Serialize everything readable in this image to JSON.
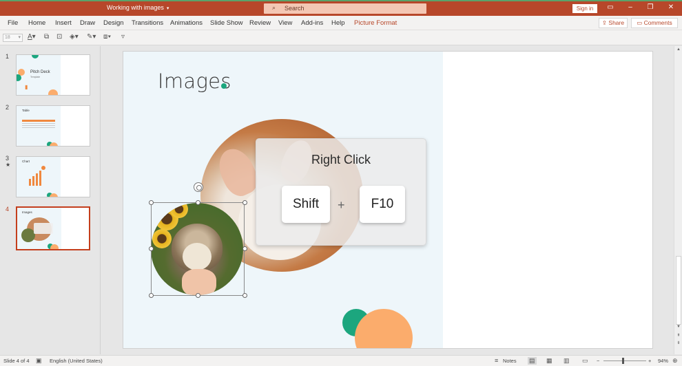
{
  "titlebar": {
    "doc_title": "Working with images",
    "search_placeholder": "Search",
    "signin_label": "Sign in",
    "icons": [
      "ribbon-display-icon",
      "minimize-icon",
      "restore-icon",
      "close-icon"
    ]
  },
  "menu": {
    "items": [
      "File",
      "Home",
      "Insert",
      "Draw",
      "Design",
      "Transitions",
      "Animations",
      "Slide Show",
      "Review",
      "View",
      "Add-ins",
      "Help",
      "Picture Format"
    ],
    "active": "Picture Format",
    "share_label": "Share",
    "comments_label": "Comments"
  },
  "toolbar": {
    "font_size": "18"
  },
  "thumbnails": [
    {
      "number": "1",
      "title": "Pitch Deck",
      "subtitle": "Template"
    },
    {
      "number": "2",
      "title": "Table"
    },
    {
      "number": "3",
      "title": "Chart"
    },
    {
      "number": "4",
      "title": "Images",
      "selected": true
    }
  ],
  "slide": {
    "title": "Images",
    "overlay_title": "Right Click",
    "key1": "Shift",
    "plus": "+",
    "key2": "F10"
  },
  "status": {
    "slide_info": "Slide 4 of 4",
    "language": "English (United States)",
    "notes_label": "Notes",
    "zoom_minus": "−",
    "zoom_plus": "+",
    "zoom": "94%"
  },
  "colors": {
    "accent": "#b7472a",
    "slide_green": "#1ca67e",
    "slide_orange": "#fbac6c"
  }
}
